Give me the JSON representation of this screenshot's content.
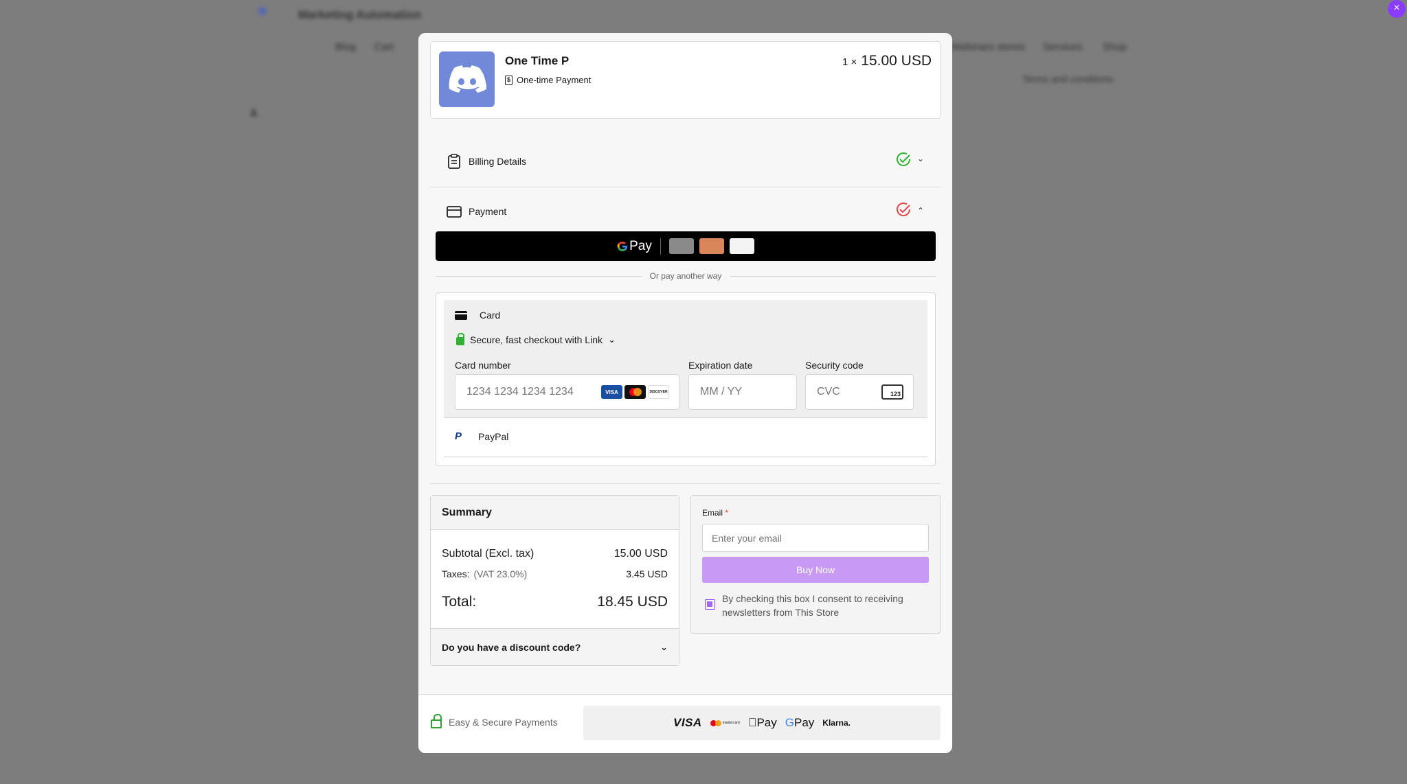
{
  "background": {
    "site_title": "Marketing Automation",
    "nav": [
      "Blog",
      "Cart",
      "Webinars stores",
      "Services",
      "Shop"
    ],
    "terms_link": "Terms and conditions"
  },
  "modal": {
    "close_label": "×",
    "product": {
      "name": "One Time P",
      "type_label": "One-time Payment",
      "qty": "1 ×",
      "price": "15.00 USD"
    },
    "billing": {
      "title": "Billing Details"
    },
    "payment": {
      "title": "Payment",
      "gpay_label": "Pay",
      "or_text": "Or pay another way",
      "card_tab": "Card",
      "link_text": "Secure, fast checkout with Link",
      "card_number_label": "Card number",
      "card_number_placeholder": "1234 1234 1234 1234",
      "expiry_label": "Expiration date",
      "expiry_placeholder": "MM / YY",
      "cvc_label": "Security code",
      "cvc_placeholder": "CVC",
      "cvc_badge": "123",
      "paypal_label": "PayPal",
      "badges": [
        "VISA",
        "DISCOVER"
      ]
    },
    "summary": {
      "title": "Summary",
      "subtotal_label": "Subtotal (Excl. tax)",
      "subtotal_value": "15.00 USD",
      "taxes_label": "Taxes:",
      "taxes_rate": "(VAT 23.0%)",
      "taxes_value": "3.45 USD",
      "total_label": "Total:",
      "total_value": "18.45 USD",
      "discount_label": "Do you have a discount code?"
    },
    "checkout": {
      "email_label": "Email",
      "email_required": "*",
      "email_placeholder": "Enter your email",
      "buy_label": "Buy Now",
      "consent_text": "By checking this box I consent to receiving newsletters from This Store",
      "consent_checked": true
    },
    "footer": {
      "secure_text": "Easy & Secure Payments",
      "brands": [
        "VISA",
        "Pay",
        "Pay",
        "Klarna."
      ]
    }
  },
  "colors": {
    "accent": "#8b3dff",
    "buy_button": "#c89af5",
    "discord": "#7289da",
    "success": "#30b130",
    "error": "#e04848"
  }
}
